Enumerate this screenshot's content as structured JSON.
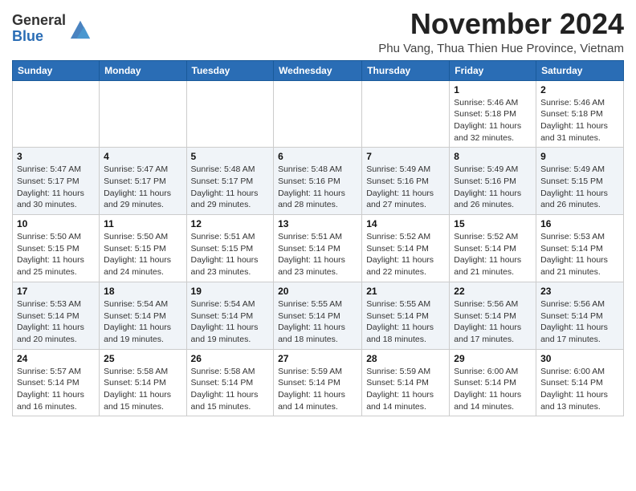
{
  "logo": {
    "general": "General",
    "blue": "Blue"
  },
  "header": {
    "month_title": "November 2024",
    "subtitle": "Phu Vang, Thua Thien Hue Province, Vietnam"
  },
  "days_of_week": [
    "Sunday",
    "Monday",
    "Tuesday",
    "Wednesday",
    "Thursday",
    "Friday",
    "Saturday"
  ],
  "weeks": [
    [
      {
        "day": "",
        "info": ""
      },
      {
        "day": "",
        "info": ""
      },
      {
        "day": "",
        "info": ""
      },
      {
        "day": "",
        "info": ""
      },
      {
        "day": "",
        "info": ""
      },
      {
        "day": "1",
        "info": "Sunrise: 5:46 AM\nSunset: 5:18 PM\nDaylight: 11 hours and 32 minutes."
      },
      {
        "day": "2",
        "info": "Sunrise: 5:46 AM\nSunset: 5:18 PM\nDaylight: 11 hours and 31 minutes."
      }
    ],
    [
      {
        "day": "3",
        "info": "Sunrise: 5:47 AM\nSunset: 5:17 PM\nDaylight: 11 hours and 30 minutes."
      },
      {
        "day": "4",
        "info": "Sunrise: 5:47 AM\nSunset: 5:17 PM\nDaylight: 11 hours and 29 minutes."
      },
      {
        "day": "5",
        "info": "Sunrise: 5:48 AM\nSunset: 5:17 PM\nDaylight: 11 hours and 29 minutes."
      },
      {
        "day": "6",
        "info": "Sunrise: 5:48 AM\nSunset: 5:16 PM\nDaylight: 11 hours and 28 minutes."
      },
      {
        "day": "7",
        "info": "Sunrise: 5:49 AM\nSunset: 5:16 PM\nDaylight: 11 hours and 27 minutes."
      },
      {
        "day": "8",
        "info": "Sunrise: 5:49 AM\nSunset: 5:16 PM\nDaylight: 11 hours and 26 minutes."
      },
      {
        "day": "9",
        "info": "Sunrise: 5:49 AM\nSunset: 5:15 PM\nDaylight: 11 hours and 26 minutes."
      }
    ],
    [
      {
        "day": "10",
        "info": "Sunrise: 5:50 AM\nSunset: 5:15 PM\nDaylight: 11 hours and 25 minutes."
      },
      {
        "day": "11",
        "info": "Sunrise: 5:50 AM\nSunset: 5:15 PM\nDaylight: 11 hours and 24 minutes."
      },
      {
        "day": "12",
        "info": "Sunrise: 5:51 AM\nSunset: 5:15 PM\nDaylight: 11 hours and 23 minutes."
      },
      {
        "day": "13",
        "info": "Sunrise: 5:51 AM\nSunset: 5:14 PM\nDaylight: 11 hours and 23 minutes."
      },
      {
        "day": "14",
        "info": "Sunrise: 5:52 AM\nSunset: 5:14 PM\nDaylight: 11 hours and 22 minutes."
      },
      {
        "day": "15",
        "info": "Sunrise: 5:52 AM\nSunset: 5:14 PM\nDaylight: 11 hours and 21 minutes."
      },
      {
        "day": "16",
        "info": "Sunrise: 5:53 AM\nSunset: 5:14 PM\nDaylight: 11 hours and 21 minutes."
      }
    ],
    [
      {
        "day": "17",
        "info": "Sunrise: 5:53 AM\nSunset: 5:14 PM\nDaylight: 11 hours and 20 minutes."
      },
      {
        "day": "18",
        "info": "Sunrise: 5:54 AM\nSunset: 5:14 PM\nDaylight: 11 hours and 19 minutes."
      },
      {
        "day": "19",
        "info": "Sunrise: 5:54 AM\nSunset: 5:14 PM\nDaylight: 11 hours and 19 minutes."
      },
      {
        "day": "20",
        "info": "Sunrise: 5:55 AM\nSunset: 5:14 PM\nDaylight: 11 hours and 18 minutes."
      },
      {
        "day": "21",
        "info": "Sunrise: 5:55 AM\nSunset: 5:14 PM\nDaylight: 11 hours and 18 minutes."
      },
      {
        "day": "22",
        "info": "Sunrise: 5:56 AM\nSunset: 5:14 PM\nDaylight: 11 hours and 17 minutes."
      },
      {
        "day": "23",
        "info": "Sunrise: 5:56 AM\nSunset: 5:14 PM\nDaylight: 11 hours and 17 minutes."
      }
    ],
    [
      {
        "day": "24",
        "info": "Sunrise: 5:57 AM\nSunset: 5:14 PM\nDaylight: 11 hours and 16 minutes."
      },
      {
        "day": "25",
        "info": "Sunrise: 5:58 AM\nSunset: 5:14 PM\nDaylight: 11 hours and 15 minutes."
      },
      {
        "day": "26",
        "info": "Sunrise: 5:58 AM\nSunset: 5:14 PM\nDaylight: 11 hours and 15 minutes."
      },
      {
        "day": "27",
        "info": "Sunrise: 5:59 AM\nSunset: 5:14 PM\nDaylight: 11 hours and 14 minutes."
      },
      {
        "day": "28",
        "info": "Sunrise: 5:59 AM\nSunset: 5:14 PM\nDaylight: 11 hours and 14 minutes."
      },
      {
        "day": "29",
        "info": "Sunrise: 6:00 AM\nSunset: 5:14 PM\nDaylight: 11 hours and 14 minutes."
      },
      {
        "day": "30",
        "info": "Sunrise: 6:00 AM\nSunset: 5:14 PM\nDaylight: 11 hours and 13 minutes."
      }
    ]
  ]
}
